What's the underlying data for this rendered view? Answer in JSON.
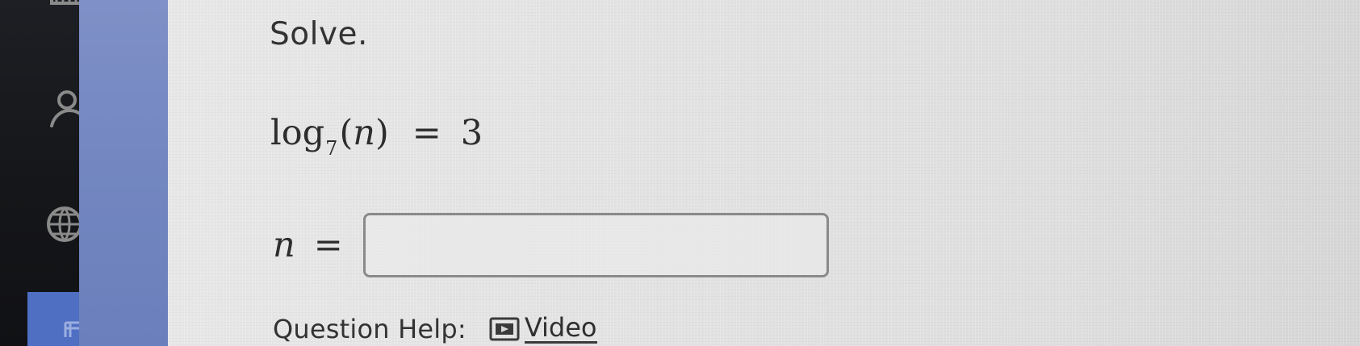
{
  "prompt": {
    "text": "Solve."
  },
  "equation": {
    "log": "log",
    "base": "7",
    "open_paren": "(",
    "variable": "n",
    "close_paren": ")",
    "equals": "=",
    "result": "3"
  },
  "answer": {
    "variable": "n",
    "equals": "=",
    "value": "",
    "placeholder": ""
  },
  "help": {
    "label": "Question Help:",
    "video_label": "Video",
    "video_icon": "video-play-icon"
  },
  "left_rail": {
    "icons": [
      "app-icon",
      "user-icon",
      "globe-icon",
      "menu-icon"
    ]
  },
  "colors": {
    "blue_strip": "#7386c0",
    "active_tab": "#4e6fc2",
    "panel_bg": "#e3e3e3",
    "text": "#333333"
  }
}
